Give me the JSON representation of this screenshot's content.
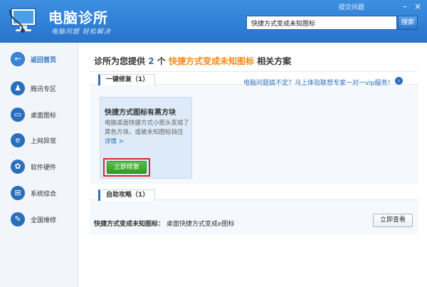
{
  "header": {
    "title": "电脑诊所",
    "slogan": "电脑问题 轻松解决",
    "feedback_label": "提交问题",
    "minimize_label": "–",
    "close_label": "×",
    "search_value": "快捷方式变成未知图标",
    "search_button_label": "搜索"
  },
  "sidebar": {
    "items": [
      {
        "label": "返回首页",
        "icon": "back-arrow-icon",
        "glyph": "←"
      },
      {
        "label": "腾讯专区",
        "icon": "penguin-icon",
        "glyph": "♟"
      },
      {
        "label": "桌面图标",
        "icon": "monitor-icon",
        "glyph": "▭"
      },
      {
        "label": "上网异常",
        "icon": "browser-icon",
        "glyph": "e"
      },
      {
        "label": "软件硬件",
        "icon": "gear-icon",
        "glyph": "✿"
      },
      {
        "label": "系统综合",
        "icon": "windows-icon",
        "glyph": "⊞"
      },
      {
        "label": "全国维修",
        "icon": "wrench-icon",
        "glyph": "✎"
      }
    ]
  },
  "main": {
    "result_prefix": "诊所为您提供",
    "result_count": "2",
    "result_count_suffix": "个",
    "result_keyword": "快捷方式变成未知图标",
    "result_suffix": "相关方案",
    "quick_fix": {
      "section_label": "一键修复（1）",
      "expert_link": "电脑问题搞不定？马上体验联想专家一对一vip服务！",
      "card_title": "快捷方式图标有黑方块",
      "card_description": "电脑桌面快捷方式小箭头变成了黑色方块，或被未知图标挡住",
      "card_more": "详情 >",
      "fix_button_label": "立即修复"
    },
    "self_help": {
      "section_label": "自助攻略（1）",
      "guide_title": "快捷方式变成未知图标：",
      "guide_text": "桌面快捷方式变成e图标",
      "view_button_label": "立即查看"
    }
  }
}
